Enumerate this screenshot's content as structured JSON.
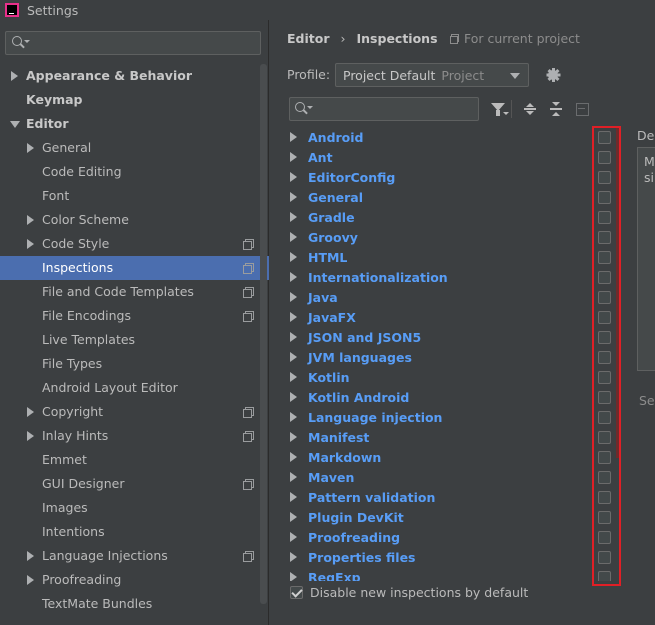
{
  "window": {
    "title": "Settings"
  },
  "sidebar": {
    "search_placeholder": "",
    "items": [
      {
        "label": "Appearance & Behavior",
        "level": 0,
        "arrow": "right",
        "bold": true,
        "copy": false
      },
      {
        "label": "Keymap",
        "level": 0,
        "arrow": "none",
        "bold": true,
        "copy": false
      },
      {
        "label": "Editor",
        "level": 0,
        "arrow": "down",
        "bold": true,
        "copy": false
      },
      {
        "label": "General",
        "level": 1,
        "arrow": "right",
        "bold": false,
        "copy": false
      },
      {
        "label": "Code Editing",
        "level": 1,
        "arrow": "none",
        "bold": false,
        "copy": false
      },
      {
        "label": "Font",
        "level": 1,
        "arrow": "none",
        "bold": false,
        "copy": false
      },
      {
        "label": "Color Scheme",
        "level": 1,
        "arrow": "right",
        "bold": false,
        "copy": false
      },
      {
        "label": "Code Style",
        "level": 1,
        "arrow": "right",
        "bold": false,
        "copy": true
      },
      {
        "label": "Inspections",
        "level": 1,
        "arrow": "none",
        "bold": false,
        "copy": true,
        "selected": true
      },
      {
        "label": "File and Code Templates",
        "level": 1,
        "arrow": "none",
        "bold": false,
        "copy": true
      },
      {
        "label": "File Encodings",
        "level": 1,
        "arrow": "none",
        "bold": false,
        "copy": true
      },
      {
        "label": "Live Templates",
        "level": 1,
        "arrow": "none",
        "bold": false,
        "copy": false
      },
      {
        "label": "File Types",
        "level": 1,
        "arrow": "none",
        "bold": false,
        "copy": false
      },
      {
        "label": "Android Layout Editor",
        "level": 1,
        "arrow": "none",
        "bold": false,
        "copy": false
      },
      {
        "label": "Copyright",
        "level": 1,
        "arrow": "right",
        "bold": false,
        "copy": true
      },
      {
        "label": "Inlay Hints",
        "level": 1,
        "arrow": "right",
        "bold": false,
        "copy": true
      },
      {
        "label": "Emmet",
        "level": 1,
        "arrow": "none",
        "bold": false,
        "copy": false
      },
      {
        "label": "GUI Designer",
        "level": 1,
        "arrow": "none",
        "bold": false,
        "copy": true
      },
      {
        "label": "Images",
        "level": 1,
        "arrow": "none",
        "bold": false,
        "copy": false
      },
      {
        "label": "Intentions",
        "level": 1,
        "arrow": "none",
        "bold": false,
        "copy": false
      },
      {
        "label": "Language Injections",
        "level": 1,
        "arrow": "right",
        "bold": false,
        "copy": true
      },
      {
        "label": "Proofreading",
        "level": 1,
        "arrow": "right",
        "bold": false,
        "copy": false
      },
      {
        "label": "TextMate Bundles",
        "level": 1,
        "arrow": "none",
        "bold": false,
        "copy": false
      }
    ]
  },
  "main": {
    "breadcrumb": [
      "Editor",
      "Inspections"
    ],
    "breadcrumb_sep": "›",
    "scope_label": "For current project",
    "profile_label": "Profile:",
    "profile_value": "Project Default",
    "profile_sub": "Project",
    "search_placeholder": "",
    "inspections": [
      "Android",
      "Ant",
      "EditorConfig",
      "General",
      "Gradle",
      "Groovy",
      "HTML",
      "Internationalization",
      "Java",
      "JavaFX",
      "JSON and JSON5",
      "JVM languages",
      "Kotlin",
      "Kotlin Android",
      "Language injection",
      "Manifest",
      "Markdown",
      "Maven",
      "Pattern validation",
      "Plugin DevKit",
      "Proofreading",
      "Properties files",
      "RegExp"
    ],
    "footer_checkbox_label": "Disable new inspections by default",
    "footer_checkbox_checked": true,
    "description_label": "Des",
    "description_text": "M\nsi",
    "severity_label": "Sev"
  },
  "colors": {
    "background": "#3c3f41",
    "selection": "#4b6eaf",
    "link_blue": "#589df6",
    "highlight_red": "#e01f26"
  }
}
